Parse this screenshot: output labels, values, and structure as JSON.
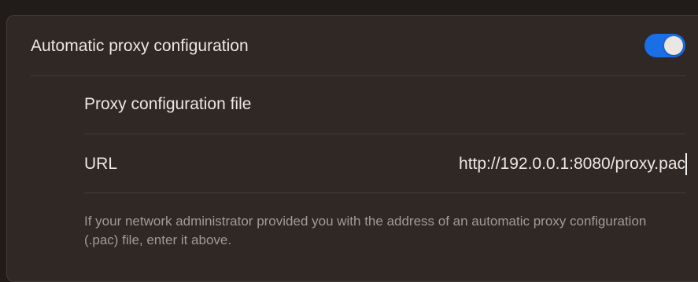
{
  "proxy": {
    "auto_config_label": "Automatic proxy configuration",
    "auto_config_enabled": true,
    "file_section_label": "Proxy configuration file",
    "url_label": "URL",
    "url_value": "http://192.0.0.1:8080/proxy.pac",
    "help_text": "If your network administrator provided you with the address of an automatic proxy configuration (.pac) file, enter it above."
  },
  "colors": {
    "toggle_on": "#1a6ee6",
    "panel_bg": "#2f2825",
    "page_bg": "#211b19"
  }
}
